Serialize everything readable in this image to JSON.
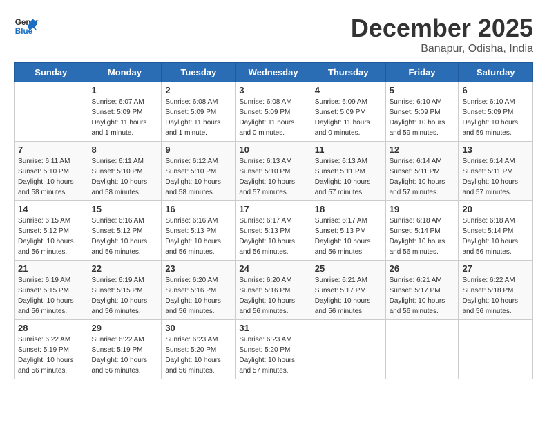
{
  "header": {
    "logo_line1": "General",
    "logo_line2": "Blue",
    "month": "December 2025",
    "location": "Banapur, Odisha, India"
  },
  "weekdays": [
    "Sunday",
    "Monday",
    "Tuesday",
    "Wednesday",
    "Thursday",
    "Friday",
    "Saturday"
  ],
  "weeks": [
    [
      {
        "day": "",
        "info": ""
      },
      {
        "day": "1",
        "info": "Sunrise: 6:07 AM\nSunset: 5:09 PM\nDaylight: 11 hours\nand 1 minute."
      },
      {
        "day": "2",
        "info": "Sunrise: 6:08 AM\nSunset: 5:09 PM\nDaylight: 11 hours\nand 1 minute."
      },
      {
        "day": "3",
        "info": "Sunrise: 6:08 AM\nSunset: 5:09 PM\nDaylight: 11 hours\nand 0 minutes."
      },
      {
        "day": "4",
        "info": "Sunrise: 6:09 AM\nSunset: 5:09 PM\nDaylight: 11 hours\nand 0 minutes."
      },
      {
        "day": "5",
        "info": "Sunrise: 6:10 AM\nSunset: 5:09 PM\nDaylight: 10 hours\nand 59 minutes."
      },
      {
        "day": "6",
        "info": "Sunrise: 6:10 AM\nSunset: 5:09 PM\nDaylight: 10 hours\nand 59 minutes."
      }
    ],
    [
      {
        "day": "7",
        "info": "Sunrise: 6:11 AM\nSunset: 5:10 PM\nDaylight: 10 hours\nand 58 minutes."
      },
      {
        "day": "8",
        "info": "Sunrise: 6:11 AM\nSunset: 5:10 PM\nDaylight: 10 hours\nand 58 minutes."
      },
      {
        "day": "9",
        "info": "Sunrise: 6:12 AM\nSunset: 5:10 PM\nDaylight: 10 hours\nand 58 minutes."
      },
      {
        "day": "10",
        "info": "Sunrise: 6:13 AM\nSunset: 5:10 PM\nDaylight: 10 hours\nand 57 minutes."
      },
      {
        "day": "11",
        "info": "Sunrise: 6:13 AM\nSunset: 5:11 PM\nDaylight: 10 hours\nand 57 minutes."
      },
      {
        "day": "12",
        "info": "Sunrise: 6:14 AM\nSunset: 5:11 PM\nDaylight: 10 hours\nand 57 minutes."
      },
      {
        "day": "13",
        "info": "Sunrise: 6:14 AM\nSunset: 5:11 PM\nDaylight: 10 hours\nand 57 minutes."
      }
    ],
    [
      {
        "day": "14",
        "info": "Sunrise: 6:15 AM\nSunset: 5:12 PM\nDaylight: 10 hours\nand 56 minutes."
      },
      {
        "day": "15",
        "info": "Sunrise: 6:16 AM\nSunset: 5:12 PM\nDaylight: 10 hours\nand 56 minutes."
      },
      {
        "day": "16",
        "info": "Sunrise: 6:16 AM\nSunset: 5:13 PM\nDaylight: 10 hours\nand 56 minutes."
      },
      {
        "day": "17",
        "info": "Sunrise: 6:17 AM\nSunset: 5:13 PM\nDaylight: 10 hours\nand 56 minutes."
      },
      {
        "day": "18",
        "info": "Sunrise: 6:17 AM\nSunset: 5:13 PM\nDaylight: 10 hours\nand 56 minutes."
      },
      {
        "day": "19",
        "info": "Sunrise: 6:18 AM\nSunset: 5:14 PM\nDaylight: 10 hours\nand 56 minutes."
      },
      {
        "day": "20",
        "info": "Sunrise: 6:18 AM\nSunset: 5:14 PM\nDaylight: 10 hours\nand 56 minutes."
      }
    ],
    [
      {
        "day": "21",
        "info": "Sunrise: 6:19 AM\nSunset: 5:15 PM\nDaylight: 10 hours\nand 56 minutes."
      },
      {
        "day": "22",
        "info": "Sunrise: 6:19 AM\nSunset: 5:15 PM\nDaylight: 10 hours\nand 56 minutes."
      },
      {
        "day": "23",
        "info": "Sunrise: 6:20 AM\nSunset: 5:16 PM\nDaylight: 10 hours\nand 56 minutes."
      },
      {
        "day": "24",
        "info": "Sunrise: 6:20 AM\nSunset: 5:16 PM\nDaylight: 10 hours\nand 56 minutes."
      },
      {
        "day": "25",
        "info": "Sunrise: 6:21 AM\nSunset: 5:17 PM\nDaylight: 10 hours\nand 56 minutes."
      },
      {
        "day": "26",
        "info": "Sunrise: 6:21 AM\nSunset: 5:17 PM\nDaylight: 10 hours\nand 56 minutes."
      },
      {
        "day": "27",
        "info": "Sunrise: 6:22 AM\nSunset: 5:18 PM\nDaylight: 10 hours\nand 56 minutes."
      }
    ],
    [
      {
        "day": "28",
        "info": "Sunrise: 6:22 AM\nSunset: 5:19 PM\nDaylight: 10 hours\nand 56 minutes."
      },
      {
        "day": "29",
        "info": "Sunrise: 6:22 AM\nSunset: 5:19 PM\nDaylight: 10 hours\nand 56 minutes."
      },
      {
        "day": "30",
        "info": "Sunrise: 6:23 AM\nSunset: 5:20 PM\nDaylight: 10 hours\nand 56 minutes."
      },
      {
        "day": "31",
        "info": "Sunrise: 6:23 AM\nSunset: 5:20 PM\nDaylight: 10 hours\nand 57 minutes."
      },
      {
        "day": "",
        "info": ""
      },
      {
        "day": "",
        "info": ""
      },
      {
        "day": "",
        "info": ""
      }
    ]
  ]
}
